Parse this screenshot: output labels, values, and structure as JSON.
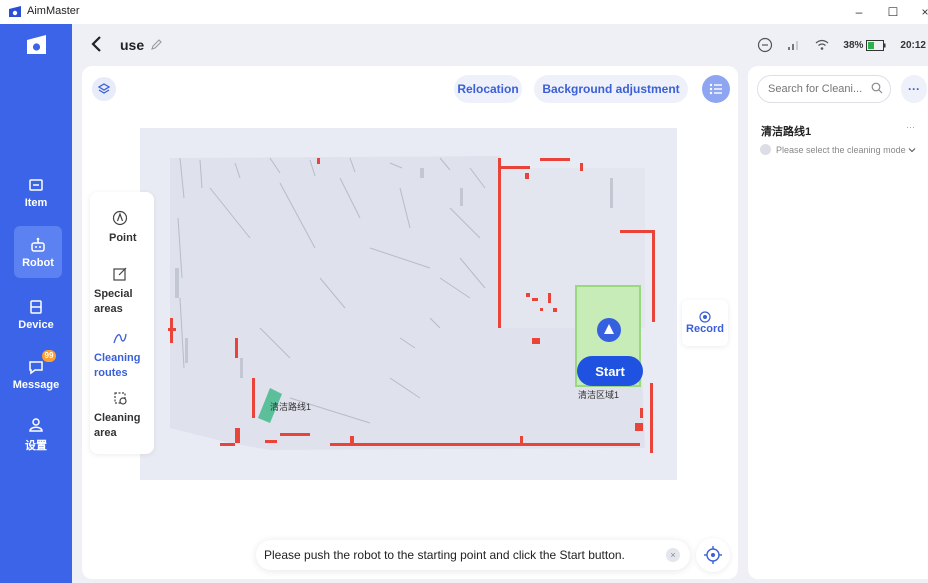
{
  "app": {
    "name": "AimMaster",
    "minimize": "–",
    "maximize": "☐",
    "close": "×"
  },
  "sidebar": {
    "items": [
      {
        "label": "Item",
        "icon": "folder-icon"
      },
      {
        "label": "Robot",
        "icon": "robot-icon",
        "active": true
      },
      {
        "label": "Device",
        "icon": "device-icon"
      },
      {
        "label": "Message",
        "icon": "message-icon",
        "badge": "99"
      },
      {
        "label": "设置",
        "icon": "settings-icon"
      }
    ]
  },
  "header": {
    "title": "use",
    "battery": "38%",
    "time": "20:12"
  },
  "toolbar": {
    "relocation": "Relocation",
    "background_adjustment": "Background adjustment"
  },
  "tools": [
    {
      "label": "Point",
      "icon": "point-icon"
    },
    {
      "label": "Special areas",
      "icon": "edit-square-icon"
    },
    {
      "label": "Cleaning routes",
      "icon": "route-icon",
      "active": true
    },
    {
      "label": "Cleaning area",
      "icon": "area-icon"
    }
  ],
  "map": {
    "route_label": "清洁路线1",
    "area_label": "清洁区域1",
    "start_label": "Start",
    "record_label": "Record"
  },
  "toast": {
    "message": "Please push the robot to the starting point and click the Start button.",
    "close": "×"
  },
  "right_panel": {
    "search_placeholder": "Search for Cleani...",
    "more": "···",
    "route_name": "清洁路线1",
    "route_more": "···",
    "mode_hint": "Please select the cleaning mode"
  },
  "colors": {
    "accent": "#3b64e8",
    "wall": "#e8443a",
    "area_fill": "#c8ecb8",
    "area_border": "#9ad880",
    "route": "#5bbf9a"
  }
}
